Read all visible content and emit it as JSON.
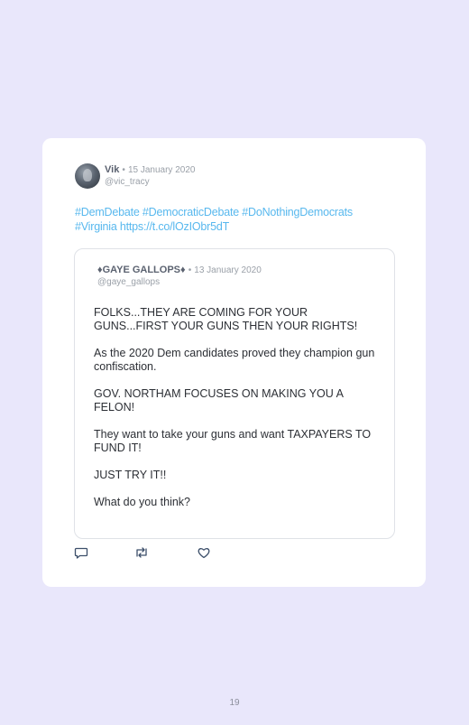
{
  "tweet": {
    "author_name": "Vik",
    "separator": "•",
    "date": "15 January 2020",
    "handle": "@vic_tracy",
    "text_line1": "#DemDebate #DemocraticDebate #DoNothingDemocrats",
    "text_line2": "#Virginia https://t.co/lOzIObr5dT"
  },
  "quoted_tweet": {
    "author_name": "♦GAYE GALLOPS♦",
    "separator": "•",
    "date": "13 January 2020",
    "handle": "@gaye_gallops",
    "paragraphs": [
      "FOLKS...THEY ARE COMING FOR YOUR GUNS...FIRST YOUR GUNS THEN YOUR RIGHTS!",
      "As the 2020 Dem candidates proved they champion gun confiscation.",
      "GOV. NORTHAM FOCUSES ON MAKING YOU A FELON!",
      "They want to take your guns and want TAXPAYERS TO FUND IT!",
      "JUST TRY IT!!",
      "What do you think?"
    ]
  },
  "actions": {
    "reply_icon": "reply-icon",
    "retweet_icon": "retweet-icon",
    "like_icon": "like-icon"
  },
  "page_number": "19"
}
